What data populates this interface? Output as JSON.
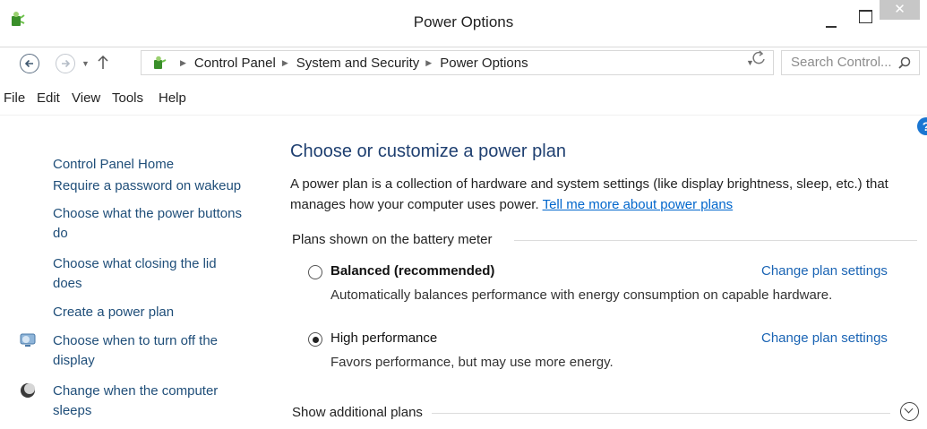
{
  "window": {
    "title": "Power Options",
    "close_glyph": "✕"
  },
  "address": {
    "breadcrumbs": [
      "Control Panel",
      "System and Security",
      "Power Options"
    ],
    "search_placeholder": "Search Control..."
  },
  "menu": [
    "File",
    "Edit",
    "View",
    "Tools",
    "Help"
  ],
  "sidebar": {
    "home": "Control Panel Home",
    "links": [
      "Require a password on wakeup",
      "Choose what the power buttons do",
      "Choose what closing the lid does",
      "Create a power plan",
      "Choose when to turn off the display",
      "Change when the computer sleeps"
    ]
  },
  "main": {
    "heading": "Choose or customize a power plan",
    "description": "A power plan is a collection of hardware and system settings (like display brightness, sleep, etc.) that manages how your computer uses power.",
    "description_link": "Tell me more about power plans",
    "group_label": "Plans shown on the battery meter",
    "plans": [
      {
        "name": "Balanced (recommended)",
        "selected": false,
        "description": "Automatically balances performance with energy consumption on capable hardware.",
        "action": "Change plan settings"
      },
      {
        "name": "High performance",
        "selected": true,
        "description": "Favors performance, but may use more energy.",
        "action": "Change plan settings"
      }
    ],
    "additional_label": "Show additional plans"
  },
  "icons": {
    "app": "power-options-icon",
    "help": "help-icon",
    "display": "display-icon",
    "sleep": "moon-icon",
    "expand": "chevron-down-icon"
  },
  "colors": {
    "link": "#1f4e79",
    "heading": "#1e3f70",
    "action_link": "#1a64b4"
  }
}
